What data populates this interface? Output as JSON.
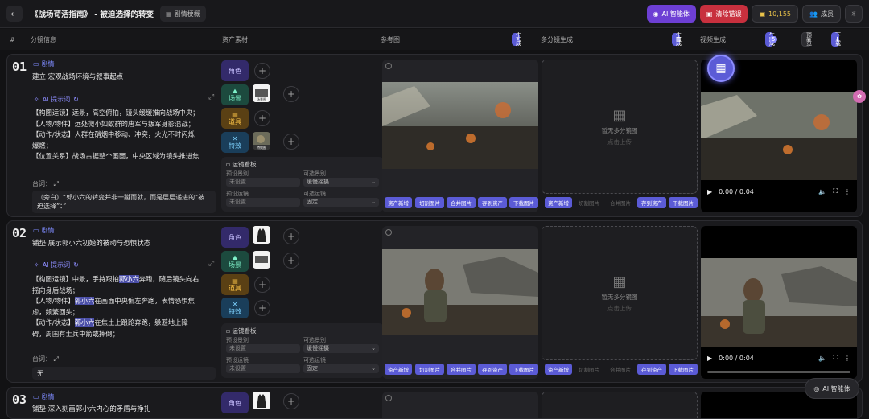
{
  "header": {
    "title": "《战场苟活指南》 - 被迫选择的转变",
    "synopsis_label": "剧情梗概",
    "ai_agent_label": "AI 智能体",
    "clear_error_label": "清除错误",
    "credits": "10,155",
    "members_label": "成员"
  },
  "columns": {
    "index": "#",
    "shot_info": "分镜信息",
    "assets": "资产素材",
    "reference": "参考图",
    "gen_label": "生成",
    "multi_shot": "多分镜生成",
    "video_gen": "视频生成",
    "gen_count": "生成",
    "gen_count_num": "5",
    "preview": "预览",
    "download": "下载"
  },
  "common": {
    "plot_tag": "剧情",
    "ai_prompt": "AI 提示词",
    "dialogue_label": "台词：",
    "role": "角色",
    "scene": "场景",
    "prop": "道具",
    "fx": "特效",
    "camera_panel": "运镜看板",
    "preset_shot": "预设景别",
    "optional_shot": "可选景别",
    "preset_move": "预设运镜",
    "optional_move": "可选运镜",
    "unset": "未设置",
    "opt_shot_value": "缓慢摇摄",
    "opt_move_value": "固定",
    "no_multi": "暂无多分镜图",
    "click_upload": "点击上传",
    "btn_asset_lib": "资产新增",
    "btn_crop": "切割图片",
    "btn_merge": "合并图片",
    "btn_save_asset": "存到资产",
    "btn_download_img": "下载图片",
    "video_time": "0:00 / 0:04",
    "thumb_scene": "场景图",
    "thumb_fx": "特效图"
  },
  "shots": [
    {
      "num": "01",
      "subtitle": "建立·宏观战场环境与叙事起点",
      "prompt": [
        "【构图运镜】远景，高空俯拍，镜头缓缓推向战场中央；",
        "【人物/物件】远处微小如蚁群的唐军与叛军身影混战；",
        "【动作/状态】人群在硝烟中移动、冲突，火光不时闪烁",
        "爆燃；",
        "【位置关系】战场占据整个画面，中央区域为镜头推进焦"
      ],
      "dialogue": "（旁白）“郭小六的转变并非一蹴而就，而是层层递进的“被迫选择”：”"
    },
    {
      "num": "02",
      "subtitle": "铺垫·展示郭小六初始的被动与恐惧状态",
      "prompt_a": "【构图运镜】中景，手持跟拍",
      "prompt_hl": "郭小六",
      "prompt_b": "奔跑，随后镜头向右",
      "prompt_c": "摇向身后战场；",
      "prompt_d": "【人物/物件】",
      "prompt_e": "在画面中央偏左奔跑，表情恐惧焦",
      "prompt_f": "虑，频繁回头；",
      "prompt_g": "【动作/状态】",
      "prompt_h": "在焦土上踉跄奔跑，躲避地上障",
      "prompt_i": "碍，周围有士兵中箭或摔倒；",
      "dialogue": "无"
    },
    {
      "num": "03",
      "subtitle": "铺垫·深入刻画郭小六内心的矛盾与挣扎"
    }
  ],
  "ai_agent_float": "AI 智能体"
}
